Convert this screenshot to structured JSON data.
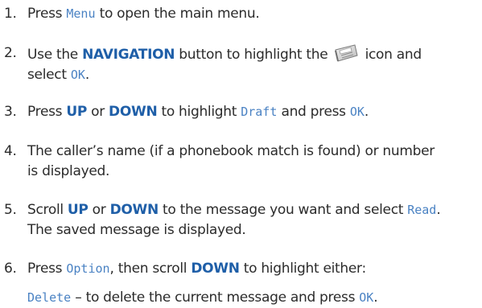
{
  "steps": [
    {
      "num": "1.",
      "parts": [
        {
          "t": "Press "
        },
        {
          "t": "Menu",
          "k": "lcd"
        },
        {
          "t": " to open the main menu."
        }
      ]
    },
    {
      "num": "2.",
      "parts": [
        {
          "t": "Use the "
        },
        {
          "t": "NAVIGATION",
          "k": "kw"
        },
        {
          "t": " button to highlight the "
        },
        {
          "icon": "messages-icon"
        },
        {
          "t": " icon and"
        },
        {
          "br": true
        },
        {
          "t": "select "
        },
        {
          "t": "OK",
          "k": "lcd"
        },
        {
          "t": "."
        }
      ]
    },
    {
      "num": "3.",
      "parts": [
        {
          "t": "Press "
        },
        {
          "t": "UP",
          "k": "kw"
        },
        {
          "t": " or "
        },
        {
          "t": "DOWN",
          "k": "kw"
        },
        {
          "t": " to highlight "
        },
        {
          "t": "Draft",
          "k": "lcd"
        },
        {
          "t": " and press "
        },
        {
          "t": "OK",
          "k": "lcd"
        },
        {
          "t": "."
        }
      ]
    },
    {
      "num": "4.",
      "parts": [
        {
          "t": "The caller’s name (if a phonebook match is found) or number"
        },
        {
          "br": true
        },
        {
          "t": "is displayed."
        }
      ]
    },
    {
      "num": "5.",
      "parts": [
        {
          "t": "Scroll "
        },
        {
          "t": "UP",
          "k": "kw"
        },
        {
          "t": " or "
        },
        {
          "t": "DOWN",
          "k": "kw"
        },
        {
          "t": " to the message you want and select "
        },
        {
          "t": "Read",
          "k": "lcd"
        },
        {
          "t": "."
        },
        {
          "br": true
        },
        {
          "t": "The saved message is displayed."
        }
      ]
    },
    {
      "num": "6.",
      "parts": [
        {
          "t": "Press "
        },
        {
          "t": "Option",
          "k": "lcd"
        },
        {
          "t": ", then scroll "
        },
        {
          "t": "DOWN",
          "k": "kw"
        },
        {
          "t": " to highlight either:"
        }
      ]
    }
  ],
  "sub_item": {
    "parts": [
      {
        "t": "Delete",
        "k": "lcd"
      },
      {
        "t": " – to delete the current message and press "
      },
      {
        "t": "OK",
        "k": "lcd"
      },
      {
        "t": "."
      }
    ]
  },
  "colors": {
    "text": "#2b2b2b",
    "keyword": "#1f5fa8",
    "lcd": "#4a82c3"
  }
}
